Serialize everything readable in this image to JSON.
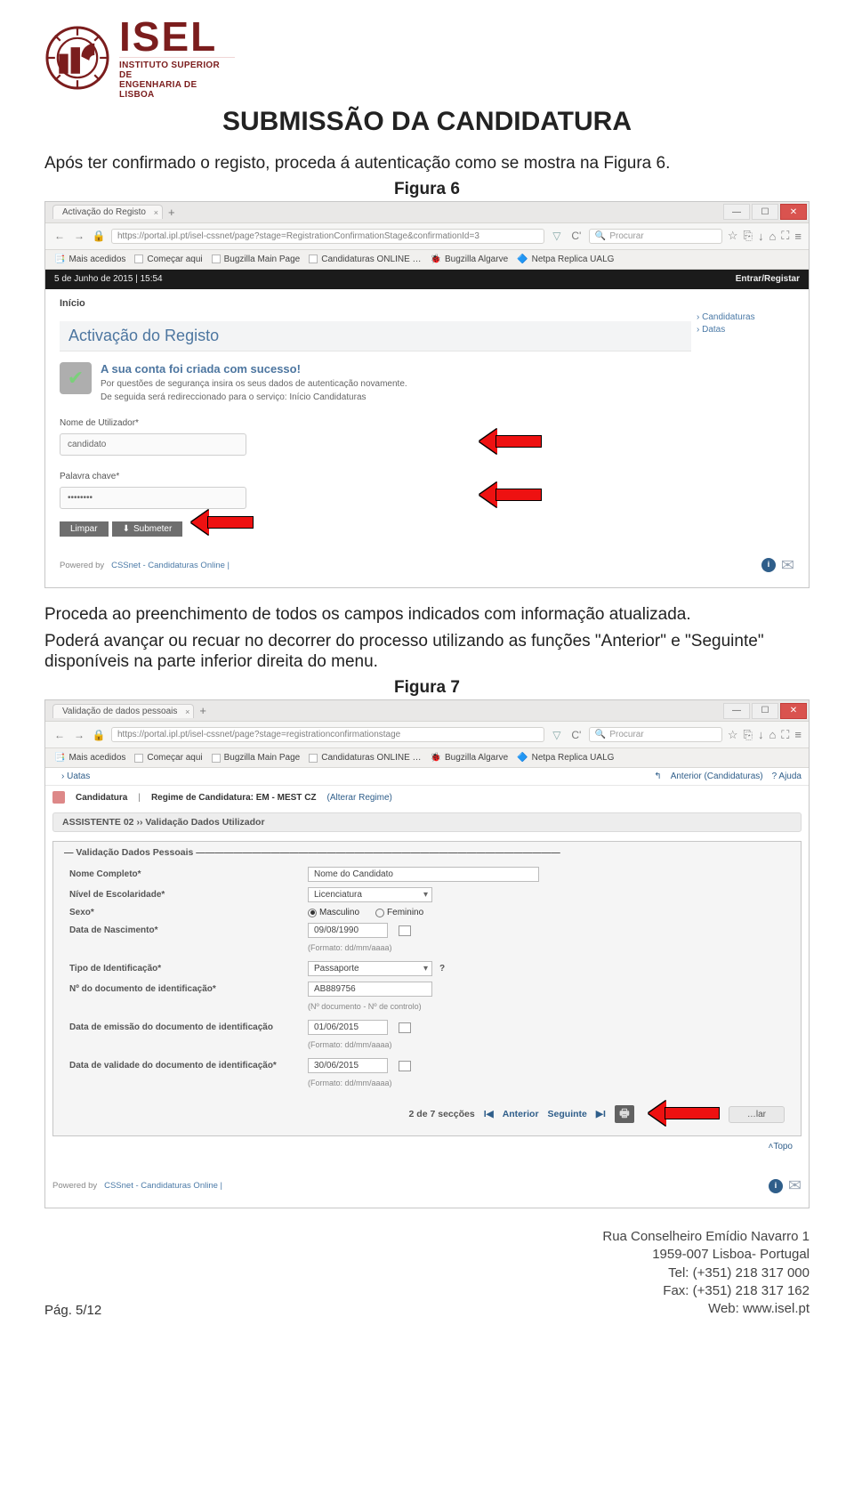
{
  "logo": {
    "main": "ISEL",
    "sub_line1": "INSTITUTO SUPERIOR DE",
    "sub_line2": "ENGENHARIA DE LISBOA"
  },
  "doc": {
    "title": "SUBMISSÃO DA CANDIDATURA",
    "para1": "Após ter confirmado o registo, proceda á autenticação como se mostra na Figura 6.",
    "fig6": "Figura 6",
    "para2a": "Proceda ao preenchimento de todos os campos indicados com informação atualizada.",
    "para2b": "Poderá avançar ou recuar no decorrer do processo utilizando as funções \"Anterior\" e \"Seguinte\" disponíveis na parte inferior direita do menu.",
    "fig7": "Figura 7",
    "page_num": "Pág. 5/12"
  },
  "browser": {
    "back": "←",
    "fwd": "→",
    "reload": "⟳",
    "search_placeholder": "Procurar",
    "star": "☆",
    "clip": "⎘",
    "down": "↓",
    "home": "⌂",
    "full": "⛶",
    "menu": "≡"
  },
  "fig6": {
    "tab": "Activação do Registo",
    "url": "https://portal.ipl.pt/isel-cssnet/page?stage=RegistrationConfirmationStage&confirmationId=3",
    "glyph_c": "C'",
    "bookmarks": [
      "Mais acedidos",
      "Começar aqui",
      "Bugzilla Main Page",
      "Candidaturas ONLINE …",
      "Bugzilla Algarve",
      "Netpa Replica UALG"
    ],
    "date": "5 de Junho de 2015 | 15:54",
    "entrar": "Entrar/Registar",
    "inicio": "Início",
    "side_candidaturas": "Candidaturas",
    "side_datas": "Datas",
    "panel_title": "Activação do Registo",
    "success_h": "A sua conta foi criada com sucesso!",
    "success_s1": "Por questões de segurança insira os seus dados de autenticação novamente.",
    "success_s2": "De seguida será redireccionado para o serviço: Início Candidaturas",
    "lab_user": "Nome de Utilizador*",
    "val_user": "candidato",
    "lab_pass": "Palavra chave*",
    "val_pass": "••••••••",
    "btn_limpar": "Limpar",
    "btn_submeter": "Submeter",
    "powered": "Powered by",
    "cssnet": "CSSnet - Candidaturas Online |"
  },
  "fig7": {
    "tab": "Validação de dados pessoais",
    "url": "https://portal.ipl.pt/isel-cssnet/page?stage=registrationconfirmationstage",
    "top_uses": "› Uatas",
    "top_anterior": "Anterior (Candidaturas)",
    "top_help": "?  Ajuda",
    "crumb_cand": "Candidatura",
    "crumb_regime": "Regime de Candidatura: EM - MEST CZ",
    "crumb_alterar": "(Alterar Regime)",
    "assist_title": "ASSISTENTE 02 ›› Validação Dados Utilizador",
    "legend": "Validação Dados Pessoais",
    "lab_nome": "Nome Completo*",
    "val_nome": "Nome do Candidato",
    "lab_nivel": "Nível de Escolaridade*",
    "val_nivel": "Licenciatura",
    "lab_sexo": "Sexo*",
    "radio_m": "Masculino",
    "radio_f": "Feminino",
    "lab_nasc": "Data de Nascimento*",
    "val_nasc": "09/08/1990",
    "fmt": "(Formato: dd/mm/aaaa)",
    "lab_tipoid": "Tipo de Identificação*",
    "val_tipoid": "Passaporte",
    "lab_ndoc": "Nº do documento de identificação*",
    "val_ndoc": "AB889756",
    "hint_ndoc": "(Nº documento - Nº de controlo)",
    "lab_emiss": "Data de emissão do documento de identificação",
    "val_emiss": "01/06/2015",
    "lab_valid": "Data de validade do documento de identificação*",
    "val_valid": "30/06/2015",
    "pager_txt": "2 de 7 secções",
    "pager_prev": "Anterior",
    "pager_next": "Seguinte",
    "cancel": "…lar",
    "topo": "Topo",
    "powered": "Powered by",
    "cssnet": "CSSnet - Candidaturas Online |"
  },
  "footer": {
    "addr": "Rua Conselheiro Emídio Navarro 1",
    "city": "1959-007 Lisboa- Portugal",
    "tel": "Tel: (+351) 218 317 000",
    "fax": "Fax: (+351) 218 317 162",
    "web": "Web: www.isel.pt"
  }
}
